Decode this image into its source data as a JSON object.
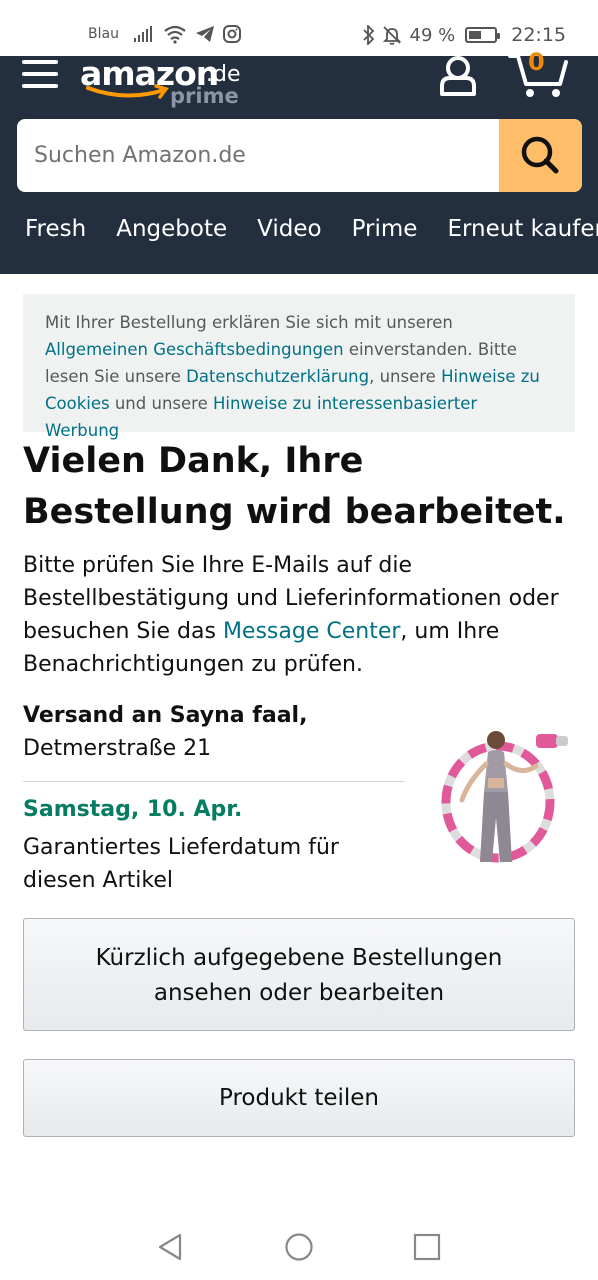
{
  "status_bar": {
    "carrier": "Blau",
    "battery": "49 %",
    "time": "22:15",
    "icons": [
      "signal-icon",
      "wifi-icon",
      "telegram-icon",
      "instagram-icon",
      "bluetooth-icon",
      "mute-icon",
      "battery-icon"
    ]
  },
  "header": {
    "logo_text": "amazon",
    "logo_tld": ".de",
    "logo_sub": "prime",
    "cart_count": "0",
    "search_placeholder": "Suchen Amazon.de",
    "nav": [
      "Fresh",
      "Angebote",
      "Video",
      "Prime",
      "Erneut kaufen"
    ]
  },
  "notice": {
    "part1": "Mit Ihrer Bestellung erklären Sie sich mit unseren ",
    "link1": "Allgemeinen Geschäftsbedingungen",
    "part2": " einverstanden. Bitte lesen Sie unsere ",
    "link2": "Datenschutzerklärung",
    "part3": ", unsere ",
    "link3": "Hinweise zu Cookies",
    "part4": " und unsere ",
    "link4": "Hinweise zu interessenbasierter Werbung"
  },
  "confirmation": {
    "heading": "Vielen Dank, Ihre Bestellung wird bearbeitet.",
    "body_part1": "Bitte prüfen Sie Ihre E-Mails auf die Bestellbestätigung und Lieferinformationen oder besuchen Sie das ",
    "body_link": "Message Center",
    "body_part2": ", um Ihre Benachrichtigungen zu prüfen."
  },
  "shipping": {
    "title": "Versand an Sayna faal,",
    "address": "Detmerstraße 21",
    "date": "Samstag, 10. Apr.",
    "note": "Garantiertes Lieferdatum für diesen Artikel"
  },
  "buttons": {
    "orders_line1": "Kürzlich aufgegebene Bestellungen",
    "orders_line2": "ansehen oder bearbeiten",
    "share": "Produkt teilen"
  },
  "colors": {
    "header_bg": "#232f3e",
    "search_button": "#febd69",
    "link": "#007185",
    "delivery_green": "#067d62",
    "cart_orange": "#f08804"
  }
}
